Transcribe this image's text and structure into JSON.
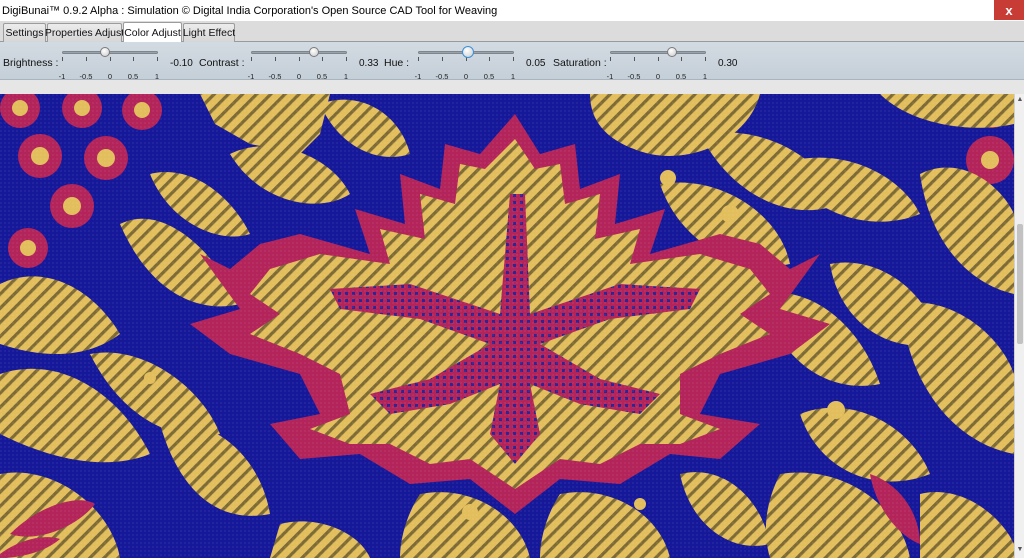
{
  "window": {
    "title": "DigiBunai™ 0.9.2 Alpha : Simulation © Digital India Corporation's Open Source CAD Tool for Weaving",
    "close_label": "x"
  },
  "tabs": [
    {
      "label": "Settings",
      "active": false
    },
    {
      "label": "Properties Adjust",
      "active": false
    },
    {
      "label": "Color Adjust",
      "active": true
    },
    {
      "label": "Light Effect",
      "active": false
    }
  ],
  "controls": {
    "brightness": {
      "label": "Brightness :",
      "value": -0.1,
      "value_text": "-0.10"
    },
    "contrast": {
      "label": "Contrast :",
      "value": 0.33,
      "value_text": "0.33"
    },
    "hue": {
      "label": "Hue :",
      "value": 0.05,
      "value_text": "0.05"
    },
    "saturation": {
      "label": "Saturation :",
      "value": 0.3,
      "value_text": "0.30"
    },
    "tick_labels": [
      "-1",
      "-0.5",
      "0",
      "0.5",
      "1"
    ]
  },
  "colors": {
    "fabric_ground": "#16189a",
    "gold_motif": "#e2be5c",
    "gold_shadow": "#8a7438",
    "red_motif": "#b3245a"
  }
}
